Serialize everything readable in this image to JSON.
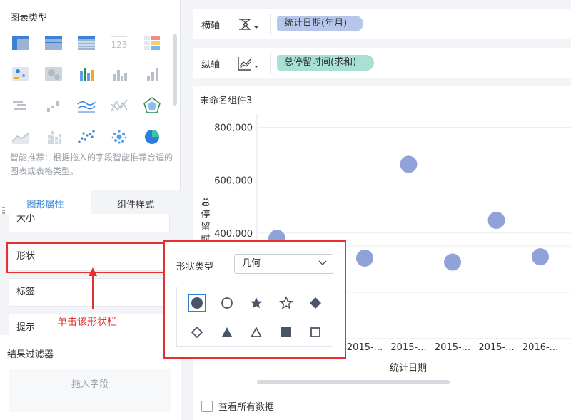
{
  "left_panel": {
    "chart_type_title": "图表类型",
    "chart_type_icons": [
      "cross-table-icon",
      "group-table-icon",
      "detail-table-icon",
      "kpi-number-icon",
      "color-table-icon",
      "point-map-icon",
      "heat-map-icon",
      "multi-bar-icon",
      "bar-chart-icon",
      "column-chart-icon",
      "range-bar-icon",
      "waterfall-icon",
      "line-chart-icon",
      "spider-line-icon",
      "radar-chart-icon",
      "area-chart-icon",
      "stacked-bar-icon",
      "scatter-chart-icon",
      "bubble-chart-icon",
      "pie-chart-icon"
    ],
    "smart_tip": "智能推荐：根据拖入的字段智能推荐合适的图表或表格类型。",
    "tabs": [
      "图形属性",
      "组件样式"
    ],
    "properties": {
      "cut_item": "大小",
      "shape": "形状",
      "label": "标签",
      "tip": "提示"
    },
    "annotation": "单击该形状栏",
    "filter_title": "结果过滤器",
    "drop_zone": "拖入字段"
  },
  "axes": {
    "x": {
      "name": "横轴",
      "field": "统计日期(年月)"
    },
    "y": {
      "name": "纵轴",
      "field": "总停留时间(求和)"
    }
  },
  "component_title": "未命名组件3",
  "view_all_label": "查看所有数据",
  "popup": {
    "shape_type_label": "形状类型",
    "shape_type_value": "几何",
    "shapes": [
      "filled-circle-icon",
      "hollow-circle-icon",
      "filled-star-icon",
      "hollow-star-icon",
      "filled-diamond-icon",
      "hollow-diamond-icon",
      "filled-triangle-icon",
      "hollow-triangle-icon",
      "filled-square-icon",
      "hollow-square-icon"
    ],
    "selected_index": 0
  },
  "colors": {
    "accent": "#2b7fd9",
    "point": "#8fa3d8",
    "annotation": "#e53030"
  },
  "chart_data": {
    "type": "scatter",
    "ylabel": "总停留时间",
    "xlabel": "统计日期",
    "ylim": [
      0,
      850000
    ],
    "yticks": [
      "400,000",
      "600,000",
      "800,000"
    ],
    "ytick_values": [
      400000,
      600000,
      800000
    ],
    "categories": [
      "2015-...",
      "2015-...",
      "2015-...",
      "2015-...",
      "2015-...",
      "2015-...",
      "2016-..."
    ],
    "visible_tick_labels": [
      "",
      "",
      "2015-...",
      "2015-...",
      "2015-...",
      "2015-...",
      "2016-..."
    ],
    "values": [
      380000,
      335000,
      305000,
      660000,
      290000,
      448000,
      310000
    ],
    "grid": true
  }
}
